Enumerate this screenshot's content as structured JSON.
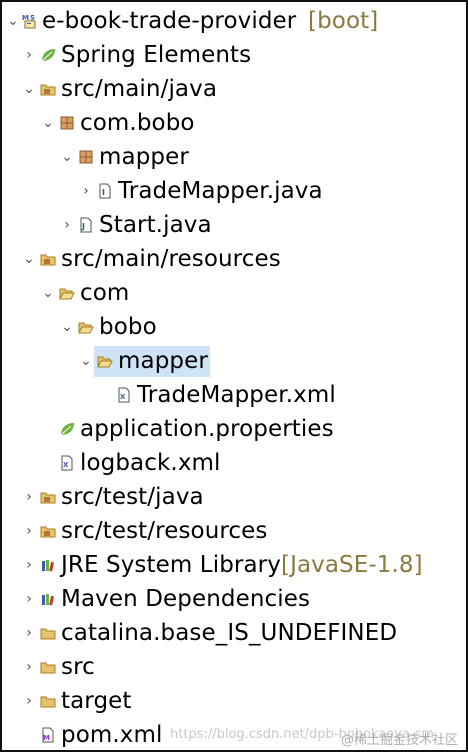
{
  "tree": [
    {
      "label": "e-book-trade-provider",
      "decoration": "[boot]",
      "icon": "maven-project-icon",
      "arrow": "expanded"
    },
    {
      "label": "Spring Elements",
      "icon": "spring-leaf-icon",
      "arrow": "collapsed"
    },
    {
      "label": "src/main/java",
      "icon": "source-folder-icon",
      "arrow": "expanded"
    },
    {
      "label": "com.bobo",
      "icon": "package-icon",
      "arrow": "expanded"
    },
    {
      "label": "mapper",
      "icon": "package-icon",
      "arrow": "expanded"
    },
    {
      "label": "TradeMapper.java",
      "icon": "java-interface-file-icon",
      "arrow": "collapsed"
    },
    {
      "label": "Start.java",
      "icon": "java-class-file-icon",
      "arrow": "collapsed"
    },
    {
      "label": "src/main/resources",
      "icon": "source-folder-icon",
      "arrow": "expanded"
    },
    {
      "label": "com",
      "icon": "folder-open-icon",
      "arrow": "expanded"
    },
    {
      "label": "bobo",
      "icon": "folder-open-icon",
      "arrow": "expanded"
    },
    {
      "label": "mapper",
      "icon": "folder-open-icon",
      "arrow": "expanded"
    },
    {
      "label": "TradeMapper.xml",
      "icon": "xml-file-icon",
      "arrow": "none"
    },
    {
      "label": "application.properties",
      "icon": "spring-leaf-icon",
      "arrow": "none"
    },
    {
      "label": "logback.xml",
      "icon": "xml-file-icon",
      "arrow": "none"
    },
    {
      "label": "src/test/java",
      "icon": "source-folder-icon",
      "arrow": "collapsed"
    },
    {
      "label": "src/test/resources",
      "icon": "source-folder-icon",
      "arrow": "collapsed"
    },
    {
      "label": "JRE System Library",
      "decoration": "[JavaSE-1.8]",
      "icon": "library-icon",
      "arrow": "collapsed"
    },
    {
      "label": "Maven Dependencies",
      "icon": "library-icon",
      "arrow": "collapsed"
    },
    {
      "label": "catalina.base_IS_UNDEFINED",
      "icon": "folder-icon",
      "arrow": "collapsed"
    },
    {
      "label": "src",
      "icon": "folder-icon",
      "arrow": "collapsed"
    },
    {
      "label": "target",
      "icon": "folder-icon",
      "arrow": "collapsed"
    },
    {
      "label": "pom.xml",
      "icon": "maven-pom-icon",
      "arrow": "none"
    }
  ],
  "selected_label": "mapper",
  "watermark": {
    "left": "https://blog.csdn.net/dpb-bobokaoya-sm",
    "right": "@稀土掘金技术社区"
  },
  "colors": {
    "selection": "#cfe3f7",
    "decoration": "#8a7a3f",
    "spring": "#6db33f",
    "folder": "#e8c26a",
    "package": "#b87333"
  }
}
